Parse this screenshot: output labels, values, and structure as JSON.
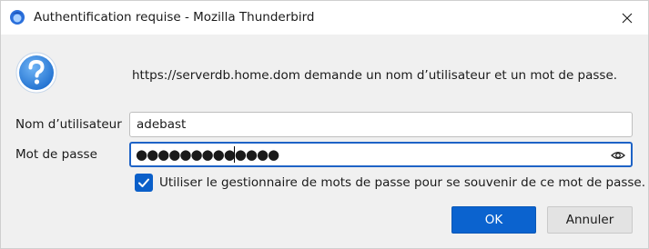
{
  "window": {
    "title": "Authentification requise - Mozilla Thunderbird",
    "close_icon": "close-icon",
    "app_icon": "thunderbird-icon"
  },
  "dialog": {
    "icon": "question-icon",
    "message": "https://serverdb.home.dom demande un nom d’utilisateur et un mot de passe."
  },
  "form": {
    "username_label": "Nom d’utilisateur",
    "username_value": "adebast",
    "password_label": "Mot de passe",
    "password_value": "●●●●●●●●●●●●●",
    "reveal_icon": "eye-icon",
    "remember_checked": true,
    "remember_label": "Utiliser le gestionnaire de mots de passe pour se souvenir de ce mot de passe."
  },
  "buttons": {
    "ok_label": "OK",
    "cancel_label": "Annuler"
  },
  "colors": {
    "accent": "#0b63cf",
    "checkbox": "#0a5fc9",
    "question_icon": "#2f86e0"
  }
}
